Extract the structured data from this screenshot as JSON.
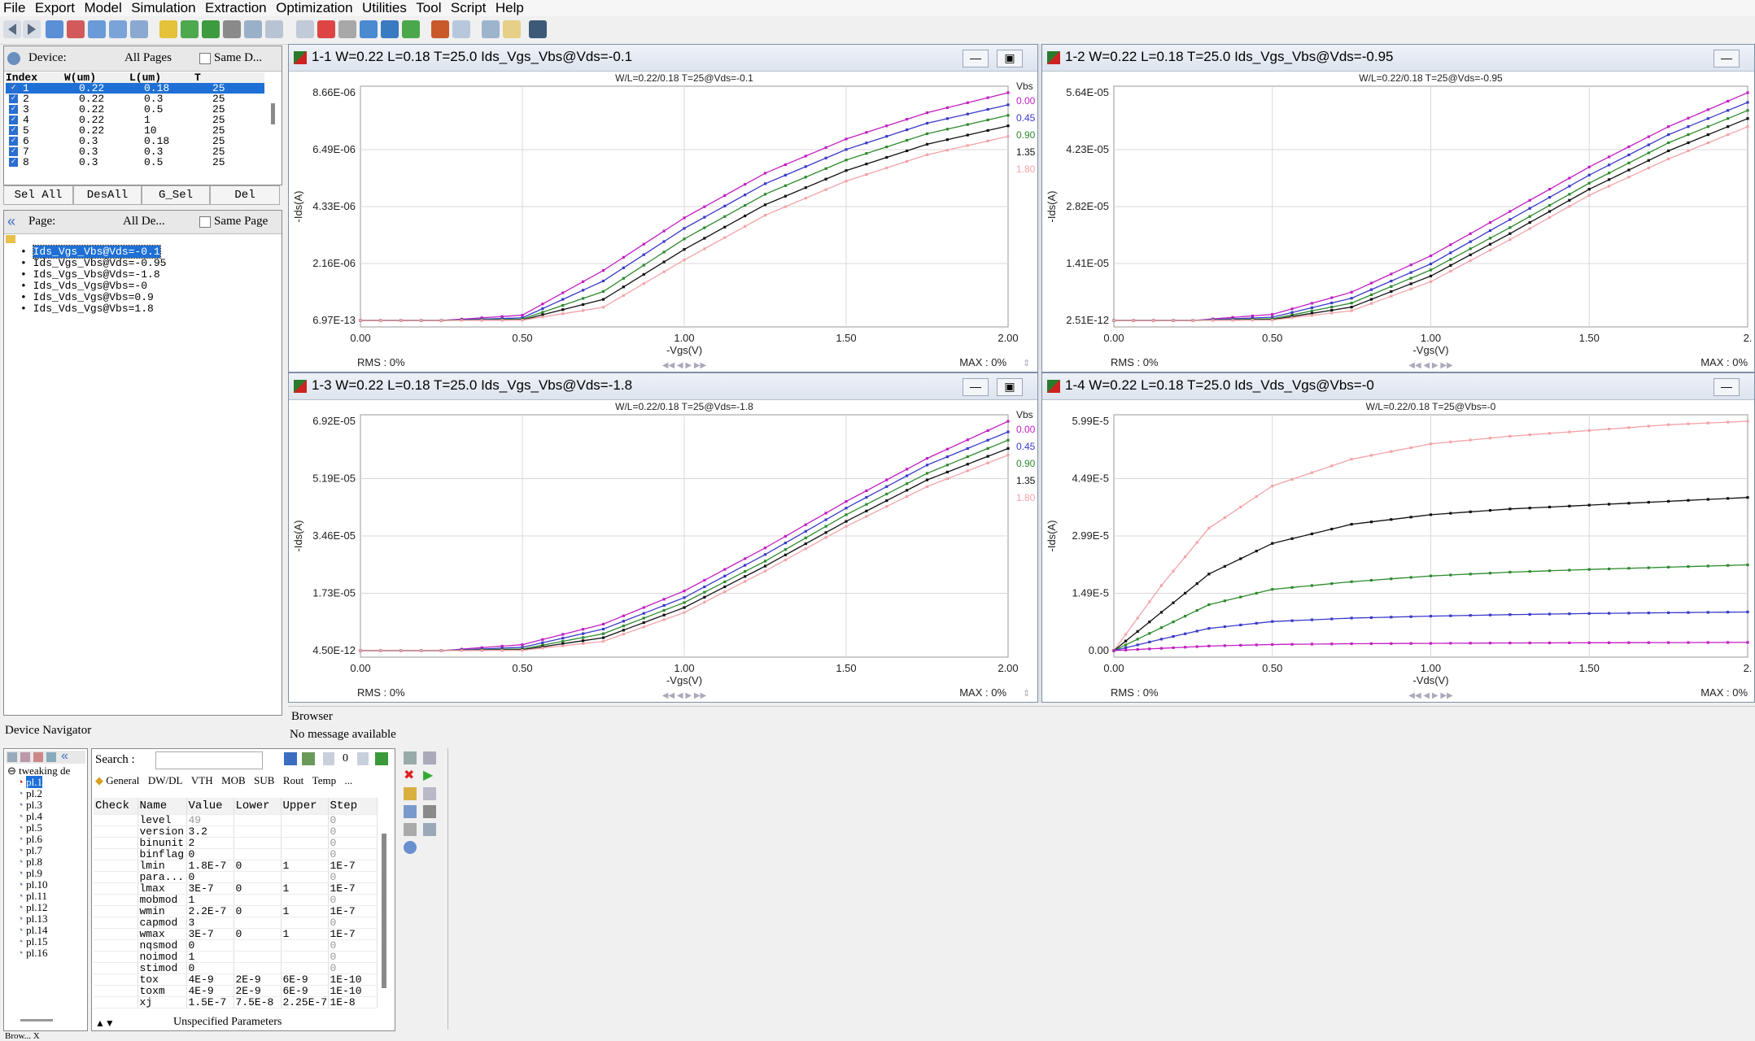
{
  "menu": [
    "File",
    "Export",
    "Model",
    "Simulation",
    "Extraction",
    "Optimization",
    "Utilities",
    "Tool",
    "Script",
    "Help"
  ],
  "device_panel": {
    "label": "Device:",
    "pages_select": "All Pages",
    "same_checkbox": "Same D...",
    "columns": [
      "Index",
      "W(um)",
      "L(um)",
      "T"
    ],
    "rows": [
      [
        "1",
        "0.22",
        "0.18",
        "25"
      ],
      [
        "2",
        "0.22",
        "0.3",
        "25"
      ],
      [
        "3",
        "0.22",
        "0.5",
        "25"
      ],
      [
        "4",
        "0.22",
        "1",
        "25"
      ],
      [
        "5",
        "0.22",
        "10",
        "25"
      ],
      [
        "6",
        "0.3",
        "0.18",
        "25"
      ],
      [
        "7",
        "0.3",
        "0.3",
        "25"
      ],
      [
        "8",
        "0.3",
        "0.5",
        "25"
      ]
    ],
    "buttons": [
      "Sel All",
      "DesAll",
      "G_Sel",
      "Del"
    ]
  },
  "page_panel": {
    "label": "Page:",
    "select": "All De...",
    "same_checkbox": "Same Page",
    "items": [
      "Ids_Vgs_Vbs@Vds=-0.1",
      "Ids_Vgs_Vbs@Vds=-0.95",
      "Ids_Vgs_Vbs@Vds=-1.8",
      "Ids_Vds_Vgs@Vbs=-0",
      "Ids_Vds_Vgs@Vbs=0.9",
      "Ids_Vds_Vgs@Vbs=1.8"
    ]
  },
  "device_navigator": "Device Navigator",
  "browser": {
    "title": "Browser",
    "message": "No message available"
  },
  "plots": [
    {
      "title": "1-1  W=0.22  L=0.18  T=25.0  Ids_Vgs_Vbs@Vds=-0.1",
      "subtitle": "W/L=0.22/0.18   T=25@Vds=-0.1",
      "yticks": [
        "8.66E-06",
        "6.49E-06",
        "4.33E-06",
        "2.16E-06",
        "6.97E-13"
      ],
      "xticks": [
        "0.00",
        "0.50",
        "1.00",
        "1.50",
        "2.00"
      ],
      "xlabel": "-Vgs(V)",
      "ylabel": "-Ids(A)",
      "rms": "RMS : 0%",
      "max": "MAX : 0%"
    },
    {
      "title": "1-2  W=0.22  L=0.18  T=25.0  Ids_Vgs_Vbs@Vds=-0.95",
      "subtitle": "W/L=0.22/0.18   T=25@Vds=-0.95",
      "yticks": [
        "5.64E-05",
        "4.23E-05",
        "2.82E-05",
        "1.41E-05",
        "2.51E-12"
      ],
      "xticks": [
        "0.00",
        "0.50",
        "1.00",
        "1.50",
        "2."
      ],
      "xlabel": "-Vgs(V)",
      "ylabel": "-Ids(A)",
      "rms": "RMS : 0%",
      "max": "MAX : 0%"
    },
    {
      "title": "1-3  W=0.22  L=0.18  T=25.0  Ids_Vgs_Vbs@Vds=-1.8",
      "subtitle": "W/L=0.22/0.18   T=25@Vds=-1.8",
      "yticks": [
        "6.92E-05",
        "5.19E-05",
        "3.46E-05",
        "1.73E-05",
        "4.50E-12"
      ],
      "xticks": [
        "0.00",
        "0.50",
        "1.00",
        "1.50",
        "2.00"
      ],
      "xlabel": "-Vgs(V)",
      "ylabel": "-Ids(A)",
      "rms": "RMS : 0%",
      "max": "MAX : 0%"
    },
    {
      "title": "1-4  W=0.22  L=0.18  T=25.0  Ids_Vds_Vgs@Vbs=-0",
      "subtitle": "W/L=0.22/0.18   T=25@Vbs=-0",
      "yticks": [
        "5.99E-5",
        "4.49E-5",
        "2.99E-5",
        "1.49E-5",
        "0.00"
      ],
      "xticks": [
        "0.00",
        "0.50",
        "1.00",
        "1.50",
        "2."
      ],
      "xlabel": "-Vds(V)",
      "ylabel": "-Ids(A)",
      "rms": "RMS : 0%",
      "max": "MAX : 0%"
    }
  ],
  "legend": {
    "title": "Vbs",
    "entries": [
      "0.00",
      "0.45",
      "0.90",
      "1.35",
      "1.80"
    ],
    "colors": [
      "#c21fc2",
      "#3a3ac8",
      "#2e8a2e",
      "#111111",
      "#f3a3a8"
    ]
  },
  "chart_data": [
    {
      "type": "line",
      "title": "W/L=0.22/0.18   T=25@Vds=-0.1",
      "xlabel": "-Vgs(V)",
      "ylabel": "-Ids(A)",
      "xlim": [
        0,
        2
      ],
      "ylim": [
        6.97e-13,
        8.66e-06
      ],
      "legend_title": "Vbs",
      "series": [
        {
          "name": "0.00",
          "x": [
            0,
            0.25,
            0.5,
            0.75,
            1.0,
            1.25,
            1.5,
            1.75,
            2.0
          ],
          "y": [
            0,
            0,
            2e-07,
            1.9e-06,
            3.9e-06,
            5.6e-06,
            6.9e-06,
            7.9e-06,
            8.66e-06
          ]
        },
        {
          "name": "0.45",
          "x": [
            0,
            0.25,
            0.5,
            0.75,
            1.0,
            1.25,
            1.5,
            1.75,
            2.0
          ],
          "y": [
            0,
            0,
            1e-07,
            1.5e-06,
            3.5e-06,
            5.2e-06,
            6.5e-06,
            7.5e-06,
            8.2e-06
          ]
        },
        {
          "name": "0.90",
          "x": [
            0,
            0.25,
            0.5,
            0.75,
            1.0,
            1.25,
            1.5,
            1.75,
            2.0
          ],
          "y": [
            0,
            0,
            5e-08,
            1.1e-06,
            3.1e-06,
            4.8e-06,
            6.1e-06,
            7.1e-06,
            7.8e-06
          ]
        },
        {
          "name": "1.35",
          "x": [
            0,
            0.25,
            0.5,
            0.75,
            1.0,
            1.25,
            1.5,
            1.75,
            2.0
          ],
          "y": [
            0,
            0,
            2e-08,
            8e-07,
            2.7e-06,
            4.4e-06,
            5.7e-06,
            6.7e-06,
            7.4e-06
          ]
        },
        {
          "name": "1.80",
          "x": [
            0,
            0.25,
            0.5,
            0.75,
            1.0,
            1.25,
            1.5,
            1.75,
            2.0
          ],
          "y": [
            0,
            0,
            1e-08,
            5e-07,
            2.3e-06,
            4e-06,
            5.3e-06,
            6.3e-06,
            7e-06
          ]
        }
      ]
    },
    {
      "type": "line",
      "title": "W/L=0.22/0.18   T=25@Vds=-0.95",
      "xlabel": "-Vgs(V)",
      "ylabel": "-Ids(A)",
      "xlim": [
        0,
        2
      ],
      "ylim": [
        2.51e-12,
        5.64e-05
      ],
      "series": [
        {
          "name": "0.00",
          "x": [
            0,
            0.25,
            0.5,
            0.75,
            1.0,
            1.25,
            1.5,
            1.75,
            2.0
          ],
          "y": [
            0,
            0,
            1.5e-06,
            7e-06,
            1.6e-05,
            2.7e-05,
            3.8e-05,
            4.8e-05,
            5.64e-05
          ]
        },
        {
          "name": "0.45",
          "x": [
            0,
            0.25,
            0.5,
            0.75,
            1.0,
            1.25,
            1.5,
            1.75,
            2.0
          ],
          "y": [
            0,
            0,
            8e-07,
            5.5e-06,
            1.4e-05,
            2.5e-05,
            3.6e-05,
            4.6e-05,
            5.4e-05
          ]
        },
        {
          "name": "0.90",
          "x": [
            0,
            0.25,
            0.5,
            0.75,
            1.0,
            1.25,
            1.5,
            1.75,
            2.0
          ],
          "y": [
            0,
            0,
            4e-07,
            4.3e-06,
            1.25e-05,
            2.3e-05,
            3.4e-05,
            4.4e-05,
            5.2e-05
          ]
        },
        {
          "name": "1.35",
          "x": [
            0,
            0.25,
            0.5,
            0.75,
            1.0,
            1.25,
            1.5,
            1.75,
            2.0
          ],
          "y": [
            0,
            0,
            2e-07,
            3.3e-06,
            1.1e-05,
            2.15e-05,
            3.25e-05,
            4.2e-05,
            5e-05
          ]
        },
        {
          "name": "1.80",
          "x": [
            0,
            0.25,
            0.5,
            0.75,
            1.0,
            1.25,
            1.5,
            1.75,
            2.0
          ],
          "y": [
            0,
            0,
            1e-07,
            2.4e-06,
            9.6e-06,
            2e-05,
            3.1e-05,
            4e-05,
            4.8e-05
          ]
        }
      ]
    },
    {
      "type": "line",
      "title": "W/L=0.22/0.18   T=25@Vds=-1.8",
      "xlabel": "-Vgs(V)",
      "ylabel": "-Ids(A)",
      "xlim": [
        0,
        2
      ],
      "ylim": [
        4.5e-12,
        6.92e-05
      ],
      "legend_title": "Vbs",
      "series": [
        {
          "name": "0.00",
          "x": [
            0,
            0.25,
            0.5,
            0.75,
            1.0,
            1.25,
            1.5,
            1.75,
            2.0
          ],
          "y": [
            0,
            0,
            1.8e-06,
            8e-06,
            1.8e-05,
            3.1e-05,
            4.5e-05,
            5.8e-05,
            6.92e-05
          ]
        },
        {
          "name": "0.45",
          "x": [
            0,
            0.25,
            0.5,
            0.75,
            1.0,
            1.25,
            1.5,
            1.75,
            2.0
          ],
          "y": [
            0,
            0,
            1e-06,
            6.5e-06,
            1.6e-05,
            2.9e-05,
            4.3e-05,
            5.6e-05,
            6.6e-05
          ]
        },
        {
          "name": "0.90",
          "x": [
            0,
            0.25,
            0.5,
            0.75,
            1.0,
            1.25,
            1.5,
            1.75,
            2.0
          ],
          "y": [
            0,
            0,
            5e-07,
            5.1e-06,
            1.45e-05,
            2.7e-05,
            4.1e-05,
            5.35e-05,
            6.35e-05
          ]
        },
        {
          "name": "1.35",
          "x": [
            0,
            0.25,
            0.5,
            0.75,
            1.0,
            1.25,
            1.5,
            1.75,
            2.0
          ],
          "y": [
            0,
            0,
            2.5e-07,
            3.9e-06,
            1.3e-05,
            2.55e-05,
            3.9e-05,
            5.15e-05,
            6.1e-05
          ]
        },
        {
          "name": "1.80",
          "x": [
            0,
            0.25,
            0.5,
            0.75,
            1.0,
            1.25,
            1.5,
            1.75,
            2.0
          ],
          "y": [
            0,
            0,
            1e-07,
            2.8e-06,
            1.15e-05,
            2.4e-05,
            3.75e-05,
            4.95e-05,
            5.9e-05
          ]
        }
      ]
    },
    {
      "type": "line",
      "title": "W/L=0.22/0.18   T=25@Vbs=-0",
      "xlabel": "-Vds(V)",
      "ylabel": "-Ids(A)",
      "xlim": [
        0,
        2
      ],
      "ylim": [
        0,
        5.99e-05
      ],
      "series": [
        {
          "x": [
            0,
            0.15,
            0.3,
            0.5,
            0.75,
            1.0,
            1.25,
            1.5,
            1.75,
            2.0
          ],
          "y": [
            0,
            1.7e-05,
            3.2e-05,
            4.3e-05,
            5e-05,
            5.4e-05,
            5.6e-05,
            5.75e-05,
            5.9e-05,
            5.99e-05
          ]
        },
        {
          "x": [
            0,
            0.15,
            0.3,
            0.5,
            0.75,
            1.0,
            1.25,
            1.5,
            1.75,
            2.0
          ],
          "y": [
            0,
            1e-05,
            2e-05,
            2.8e-05,
            3.3e-05,
            3.55e-05,
            3.7e-05,
            3.8e-05,
            3.9e-05,
            4e-05
          ]
        },
        {
          "x": [
            0,
            0.15,
            0.3,
            0.5,
            0.75,
            1.0,
            1.25,
            1.5,
            1.75,
            2.0
          ],
          "y": [
            0,
            6e-06,
            1.2e-05,
            1.6e-05,
            1.8e-05,
            1.95e-05,
            2.05e-05,
            2.12e-05,
            2.18e-05,
            2.24e-05
          ]
        },
        {
          "x": [
            0,
            0.15,
            0.3,
            0.5,
            0.75,
            1.0,
            1.25,
            1.5,
            1.75,
            2.0
          ],
          "y": [
            0,
            3e-06,
            5.8e-06,
            7.6e-06,
            8.5e-06,
            9e-06,
            9.4e-06,
            9.7e-06,
            9.9e-06,
            1.01e-05
          ]
        },
        {
          "x": [
            0,
            0.15,
            0.3,
            0.5,
            0.75,
            1.0,
            1.25,
            1.5,
            1.75,
            2.0
          ],
          "y": [
            0,
            6e-07,
            1.2e-06,
            1.6e-06,
            1.8e-06,
            1.9e-06,
            2e-06,
            2.05e-06,
            2.1e-06,
            2.15e-06
          ]
        }
      ]
    }
  ],
  "params": {
    "search_label": "Search :",
    "counter": "0",
    "tabs": [
      "General",
      "DW/DL",
      "VTH",
      "MOB",
      "SUB",
      "Rout",
      "Temp",
      "..."
    ],
    "columns": [
      "Check",
      "Name",
      "Value",
      "Lower",
      "Upper",
      "Step"
    ],
    "rows": [
      [
        "",
        "level",
        "49",
        "",
        "",
        "0"
      ],
      [
        "",
        "version",
        "3.2",
        "",
        "",
        "0"
      ],
      [
        "",
        "binunit",
        "2",
        "",
        "",
        "0"
      ],
      [
        "",
        "binflag",
        "0",
        "",
        "",
        "0"
      ],
      [
        "",
        "lmin",
        "1.8E-7",
        "0",
        "1",
        "1E-7"
      ],
      [
        "",
        "para...",
        "0",
        "",
        "",
        "0"
      ],
      [
        "",
        "lmax",
        "3E-7",
        "0",
        "1",
        "1E-7"
      ],
      [
        "",
        "mobmod",
        "1",
        "",
        "",
        "0"
      ],
      [
        "",
        "wmin",
        "2.2E-7",
        "0",
        "1",
        "1E-7"
      ],
      [
        "",
        "capmod",
        "3",
        "",
        "",
        "0"
      ],
      [
        "",
        "wmax",
        "3E-7",
        "0",
        "1",
        "1E-7"
      ],
      [
        "",
        "nqsmod",
        "0",
        "",
        "",
        "0"
      ],
      [
        "",
        "noimod",
        "1",
        "",
        "",
        "0"
      ],
      [
        "",
        "stimod",
        "0",
        "",
        "",
        "0"
      ],
      [
        "",
        "tox",
        "4E-9",
        "2E-9",
        "6E-9",
        "1E-10"
      ],
      [
        "",
        "toxm",
        "4E-9",
        "2E-9",
        "6E-9",
        "1E-10"
      ],
      [
        "",
        "xj",
        "1.5E-7",
        "7.5E-8",
        "2.25E-7",
        "1E-8"
      ]
    ],
    "footer": "Unspecified Parameters"
  },
  "navigator_tree": {
    "root": "tweaking de",
    "items": [
      "pl.1",
      "pl.2",
      "pl.3",
      "pl.4",
      "pl.5",
      "pl.6",
      "pl.7",
      "pl.8",
      "pl.9",
      "pl.10",
      "pl.11",
      "pl.12",
      "pl.13",
      "pl.14",
      "pl.15",
      "pl.16"
    ]
  },
  "status_bottom": "Brow... X"
}
